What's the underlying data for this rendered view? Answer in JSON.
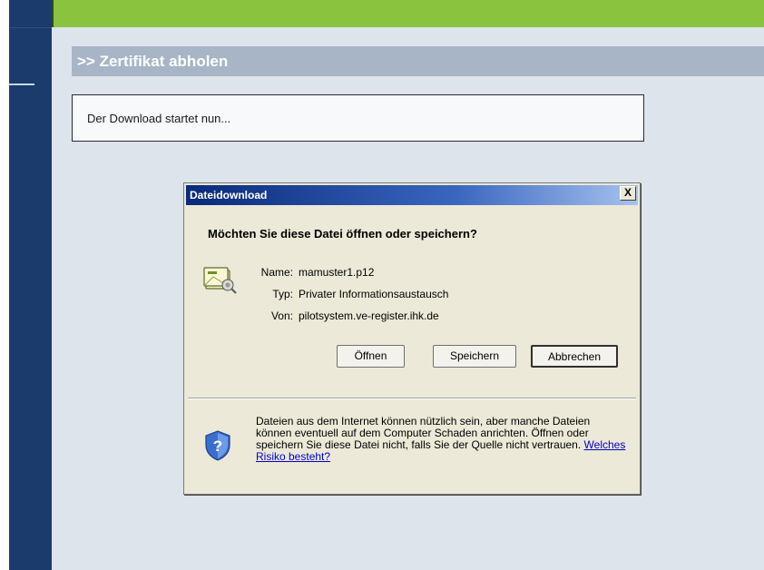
{
  "page": {
    "section_title": ">> Zertifikat abholen",
    "status_message": "Der Download startet nun..."
  },
  "dialog": {
    "title": "Dateidownload",
    "close_label": "X",
    "question": "Möchten Sie diese Datei öffnen oder speichern?",
    "file": {
      "name_label": "Name:",
      "name_value": "mamuster1.p12",
      "type_label": "Typ:",
      "type_value": "Privater Informationsaustausch",
      "from_label": "Von:",
      "from_value": "pilotsystem.ve-register.ihk.de"
    },
    "buttons": {
      "open": "Öffnen",
      "save": "Speichern",
      "cancel": "Abbrechen"
    },
    "warning_text": "Dateien aus dem Internet können nützlich sein, aber manche Dateien können eventuell auf dem Computer Schaden anrichten. Öffnen oder speichern Sie diese Datei nicht, falls Sie der Quelle nicht vertrauen.",
    "risk_link": "Welches Risiko besteht?"
  },
  "colors": {
    "top_bar": "#8ac43f",
    "sidebar": "#1a3b6b",
    "content_bg": "#dde4ec",
    "header_bg": "#a7b5c6",
    "dialog_bg": "#ece9d8"
  },
  "icons": [
    "certificate-file-icon",
    "shield-question-icon",
    "close-icon"
  ]
}
